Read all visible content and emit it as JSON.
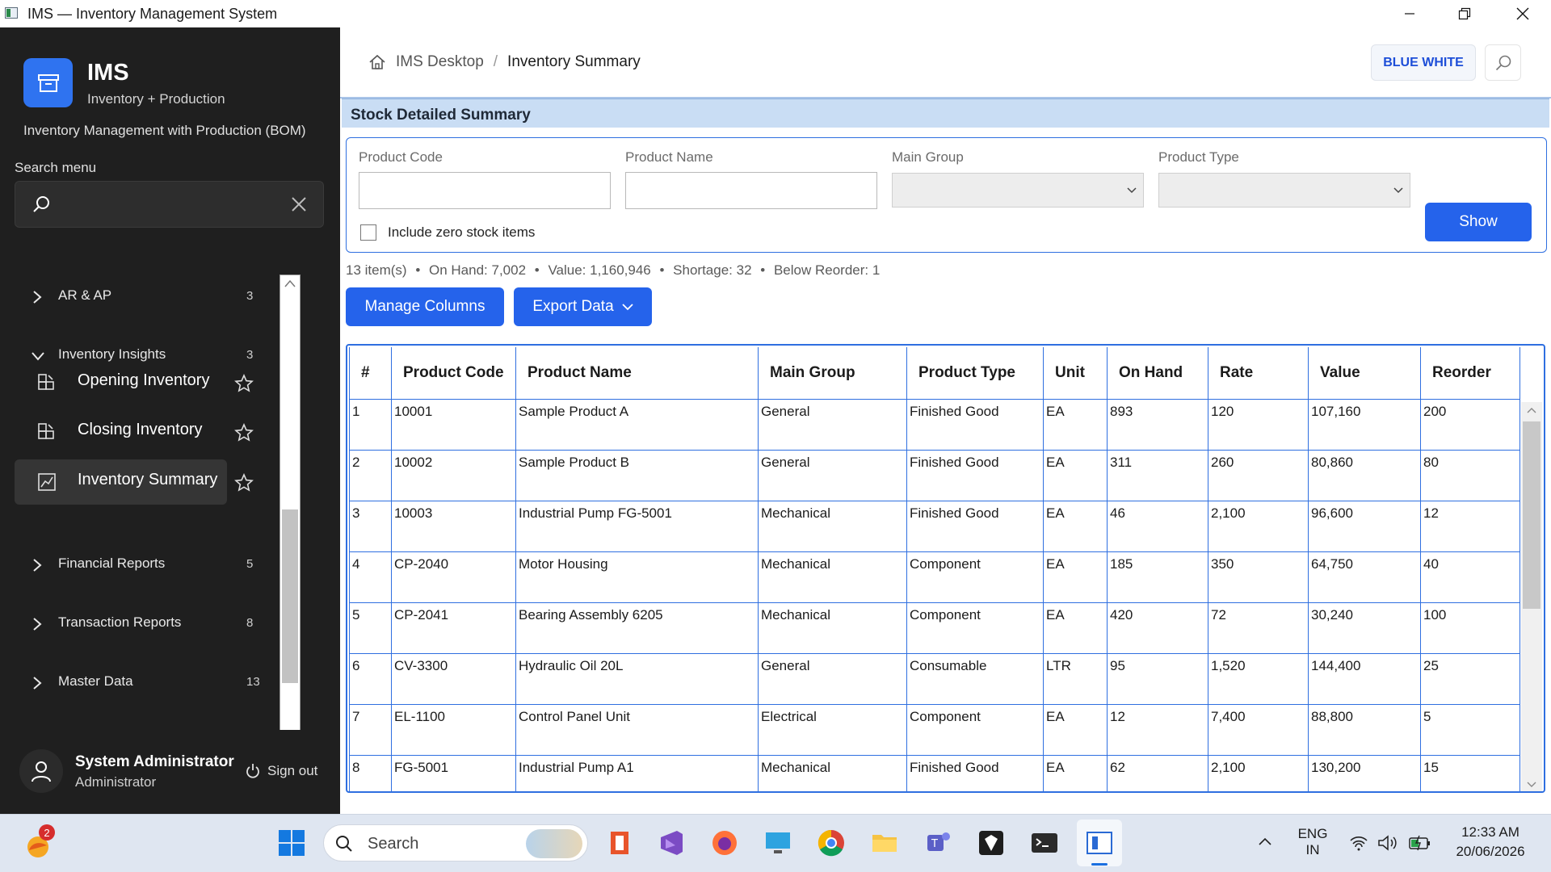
{
  "window": {
    "title": "IMS — Inventory Management System"
  },
  "sidebar": {
    "brand": "IMS",
    "brand_sub": "Inventory + Production",
    "brand_long": "Inventory Management with Production (BOM)",
    "search_label": "Search menu",
    "search_placeholder": "",
    "sections": [
      {
        "label": "AR & AP",
        "count": "3",
        "expanded": false
      },
      {
        "label": "Inventory Insights",
        "count": "3",
        "expanded": true
      },
      {
        "label": "Financial Reports",
        "count": "5",
        "expanded": false
      },
      {
        "label": "Transaction Reports",
        "count": "8",
        "expanded": false
      },
      {
        "label": "Master Data",
        "count": "13",
        "expanded": false
      }
    ],
    "subitems": [
      {
        "label": "Opening Inventory",
        "icon": "inventory-icon"
      },
      {
        "label": "Closing Inventory",
        "icon": "inventory-icon"
      },
      {
        "label": "Inventory Summary",
        "icon": "chart-icon",
        "active": true
      }
    ],
    "user": {
      "name": "System Administrator",
      "role": "Administrator",
      "signout": "Sign out"
    }
  },
  "header": {
    "breadcrumb_home": "IMS Desktop",
    "breadcrumb_current": "Inventory Summary",
    "theme_button": "BLUE WHITE"
  },
  "panel": {
    "title": "Stock Detailed Summary"
  },
  "filters": {
    "product_code_label": "Product Code",
    "product_name_label": "Product Name",
    "main_group_label": "Main Group",
    "product_type_label": "Product Type",
    "product_code_value": "",
    "product_name_value": "",
    "main_group_value": "",
    "product_type_value": "",
    "zero_stock_label": "Include zero stock items",
    "zero_stock_checked": false,
    "show_button": "Show"
  },
  "summary": {
    "items": "13 item(s)",
    "on_hand": "On Hand: 7,002",
    "value": "Value: 1,160,946",
    "shortage": "Shortage: 32",
    "below_reorder": "Below Reorder: 1"
  },
  "actions": {
    "manage_columns": "Manage Columns",
    "export_data": "Export Data"
  },
  "table": {
    "columns": [
      "#",
      "Product Code",
      "Product Name",
      "Main Group",
      "Product Type",
      "Unit",
      "On Hand",
      "Rate",
      "Value",
      "Reorder"
    ],
    "rows": [
      [
        "1",
        "10001",
        "Sample Product A",
        "General",
        "Finished Good",
        "EA",
        "893",
        "120",
        "107,160",
        "200"
      ],
      [
        "2",
        "10002",
        "Sample Product B",
        "General",
        "Finished Good",
        "EA",
        "311",
        "260",
        "80,860",
        "80"
      ],
      [
        "3",
        "10003",
        "Industrial Pump FG-5001",
        "Mechanical",
        "Finished Good",
        "EA",
        "46",
        "2,100",
        "96,600",
        "12"
      ],
      [
        "4",
        "CP-2040",
        "Motor Housing",
        "Mechanical",
        "Component",
        "EA",
        "185",
        "350",
        "64,750",
        "40"
      ],
      [
        "5",
        "CP-2041",
        "Bearing Assembly 6205",
        "Mechanical",
        "Component",
        "EA",
        "420",
        "72",
        "30,240",
        "100"
      ],
      [
        "6",
        "CV-3300",
        "Hydraulic Oil 20L",
        "General",
        "Consumable",
        "LTR",
        "95",
        "1,520",
        "144,400",
        "25"
      ],
      [
        "7",
        "EL-1100",
        "Control Panel Unit",
        "Electrical",
        "Component",
        "EA",
        "12",
        "7,400",
        "88,800",
        "5"
      ],
      [
        "8",
        "FG-5001",
        "Industrial Pump A1",
        "Mechanical",
        "Finished Good",
        "EA",
        "62",
        "2,100",
        "130,200",
        "15"
      ]
    ]
  },
  "taskbar": {
    "search_placeholder": "Search",
    "notification_badge": "2",
    "lang": "ENG",
    "region": "IN",
    "time": "12:33 AM",
    "date": "20/06/2026"
  },
  "colors": {
    "accent": "#2563eb",
    "sidebar_bg": "#1f1f1f",
    "panel_header": "#c9ddf4",
    "table_border": "#2f6fe0"
  }
}
